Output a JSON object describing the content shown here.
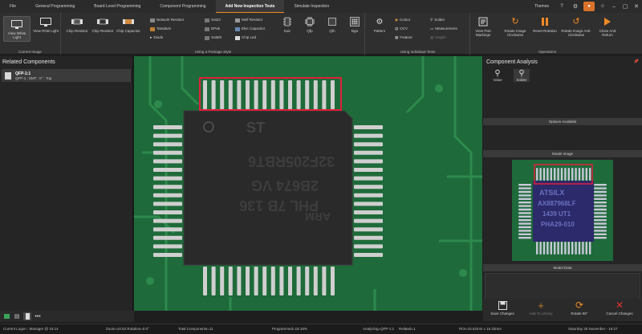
{
  "menu": {
    "tabs": [
      "File",
      "General Programming",
      "Board Level Programming",
      "Component Programming",
      "Add New Inspection Tests",
      "Simulate Inspection"
    ],
    "active_tab": "Add New Inspection Tests",
    "themes_label": "Themes",
    "window_controls": [
      "–",
      "▢",
      "✕"
    ]
  },
  "ribbon": {
    "current_image": {
      "label": "Current Image",
      "view_white": "View White Light",
      "view_rgb": "View RGB Light"
    },
    "package_style": {
      "label": "Using a Package Style",
      "chip_resistor": "Chip Resistor",
      "chip_resistor2": "Chip Resistor",
      "chip_capacitor": "Chip Capacitor",
      "network_resistor": "Network Resistor",
      "tantalum": "Tantalum",
      "diode": "Diode",
      "sot23": "Sot23",
      "dpak": "DPak",
      "sot5_6": "Sot5/6",
      "melf_resistor": "Melf Resistor",
      "elec_capacitor": "Elec Capacitor",
      "chip_led": "Chip Led",
      "soic": "Soic",
      "qfp": "Qfp",
      "qfn": "Qfn",
      "bga": "Bga"
    },
    "individual_tests": {
      "label": "Using Individual Tests",
      "pattern": "Pattern",
      "colour": "Colour",
      "ocv": "OCV",
      "feature": "Feature",
      "solder": "Solder",
      "measurement": "Measurement",
      "height": "Height"
    },
    "operations": {
      "label": "Operations",
      "view_part": "View Part Markings",
      "rotate_cw": "Rotate Image Clockwise",
      "reset_rotation": "Reset Rotation",
      "rotate_acw": "Rotate Image Anti-Clockwise",
      "close": "Close And Return"
    }
  },
  "left_panel": {
    "title": "Related Components",
    "items": [
      {
        "name": "QFP-1:1",
        "detail": "QFP-1 : SMT : 0° : Top"
      }
    ]
  },
  "right_panel": {
    "title": "Component Analysis",
    "pin": "📌",
    "value_label": "Value",
    "solder_label": "Solder",
    "options_header": "Options Available",
    "model_image_header": "Model Image",
    "model_data_header": "Model Data",
    "model_chip_text": [
      "ATSILX",
      "AX887968LF",
      "1439 UT1",
      "PHA29-010"
    ]
  },
  "chip_markings": {
    "line1": "PHL 7B 136",
    "line2": "2B674 VG",
    "line3": "32F205RBT6",
    "line4": "ARM"
  },
  "actions": {
    "save": "Save Changes",
    "add_library": "Add To Library",
    "rotate90": "Rotate 90°",
    "cancel": "Cancel Changes"
  },
  "status": {
    "logon": "Current Logon : Manager @ 16:14",
    "zoom": "Zoom=x0.62  Rotation=0.0°",
    "total": "Total Components=11",
    "programmed": "Programmed=18.18%",
    "analyzing": "Analyzing=QFP-1:1",
    "related": "Related=1",
    "roi": "ROI=15.52mm x 15.33mm",
    "datetime": "Saturday 25 November - 16:27"
  },
  "colors": {
    "accent": "#f08a24",
    "pcb": "#1e6a3a",
    "highlight": "#e0203a",
    "cancel": "#e03030"
  }
}
